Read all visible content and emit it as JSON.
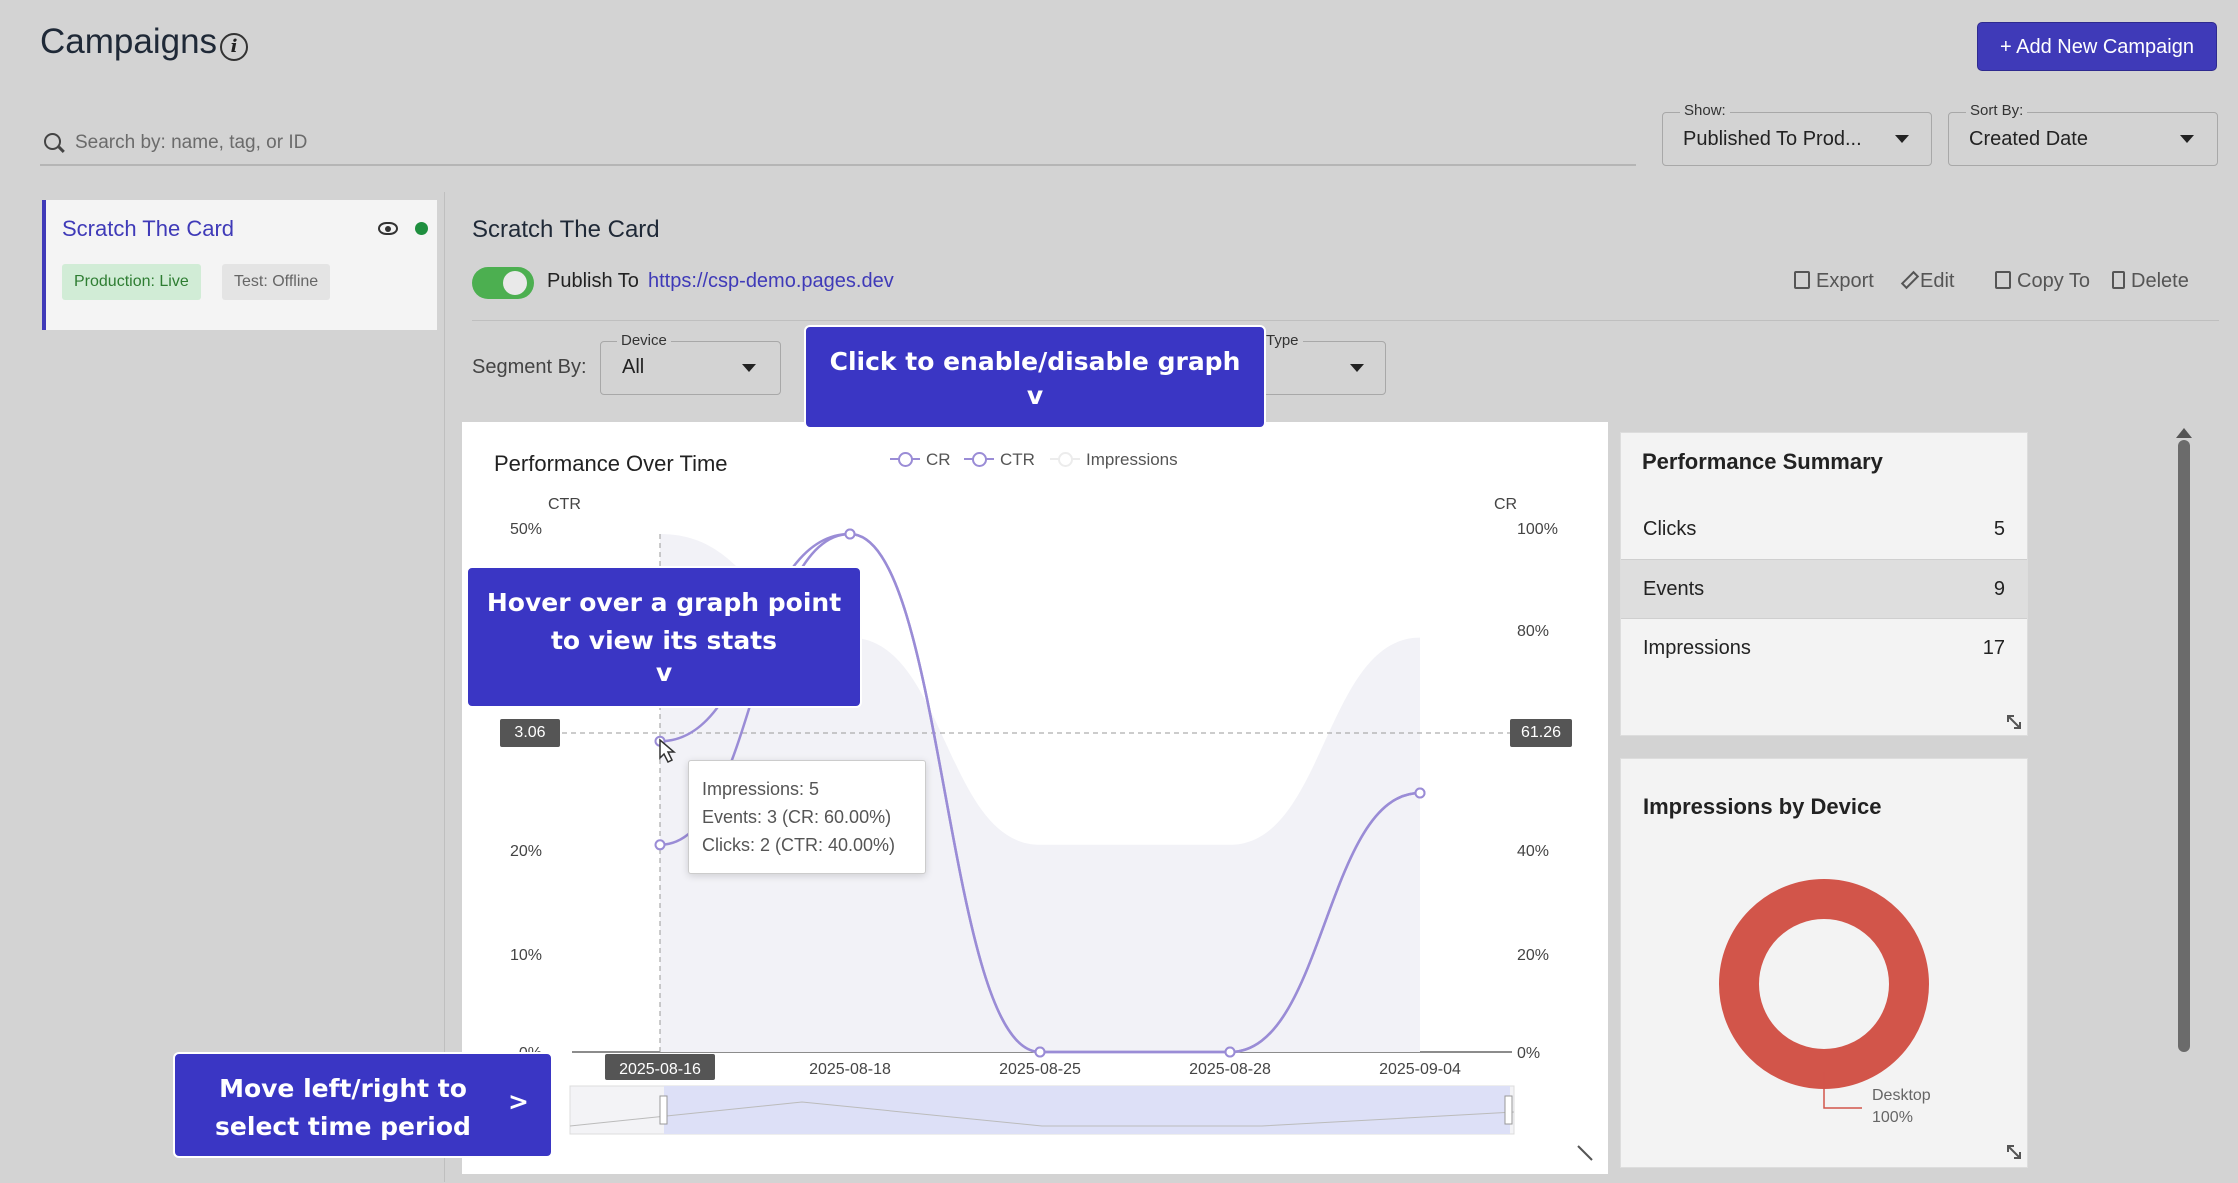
{
  "header": {
    "title": "Campaigns",
    "add_button": "+ Add New Campaign"
  },
  "search": {
    "placeholder": "Search by: name, tag, or ID"
  },
  "filters": {
    "show": {
      "label": "Show:",
      "value": "Published To Prod..."
    },
    "sort": {
      "label": "Sort By:",
      "value": "Created Date"
    }
  },
  "sidebar": {
    "campaign": {
      "name": "Scratch The Card",
      "badge_live": "Production: Live",
      "badge_test": "Test: Offline"
    }
  },
  "main": {
    "title": "Scratch The Card",
    "publish_label": "Publish To",
    "publish_url": "https://csp-demo.pages.dev",
    "actions": {
      "export": "Export",
      "edit": "Edit",
      "copy": "Copy To",
      "delete": "Delete"
    },
    "segment_label": "Segment By:",
    "device": {
      "label": "Device",
      "value": "All"
    },
    "type": {
      "label": "Type",
      "value": ""
    }
  },
  "chart": {
    "title": "Performance Over Time",
    "legend": {
      "cr": "CR",
      "ctr": "CTR",
      "impressions": "Impressions"
    },
    "left_axis_title": "CTR",
    "right_axis_title": "CR",
    "left_ticks": [
      "50%",
      "20%",
      "10%",
      "0%"
    ],
    "right_ticks": [
      "100%",
      "80%",
      "40%",
      "20%",
      "0%"
    ],
    "x_ticks": [
      "2025-08-16",
      "2025-08-18",
      "2025-08-25",
      "2025-08-28",
      "2025-09-04"
    ],
    "crosshair_left": "3.06",
    "crosshair_right": "61.26",
    "tooltip": {
      "line1": "Impressions: 5",
      "line2": "Events: 3 (CR: 60.00%)",
      "line3": "Clicks: 2 (CTR: 40.00%)"
    }
  },
  "chart_data": {
    "type": "line",
    "title": "Performance Over Time",
    "categories": [
      "2025-08-16",
      "2025-08-18",
      "2025-08-25",
      "2025-08-28",
      "2025-09-04"
    ],
    "series": [
      {
        "name": "CR",
        "values": [
          60,
          100,
          0,
          0,
          50
        ]
      },
      {
        "name": "CTR",
        "values": [
          40,
          100,
          0,
          0,
          50
        ]
      },
      {
        "name": "Impressions",
        "values": [
          5,
          4,
          2,
          2,
          4
        ]
      }
    ],
    "y_left": {
      "label": "CTR",
      "range": [
        0,
        50
      ]
    },
    "y_right": {
      "label": "CR",
      "range": [
        0,
        100
      ]
    },
    "legend_position": "top"
  },
  "summary": {
    "title": "Performance Summary",
    "rows": [
      {
        "label": "Clicks",
        "value": "5"
      },
      {
        "label": "Events",
        "value": "9"
      },
      {
        "label": "Impressions",
        "value": "17"
      }
    ]
  },
  "device_chart": {
    "title": "Impressions by Device",
    "label": "Desktop",
    "percent": "100%",
    "color": "#d2554a"
  },
  "tips": {
    "toggle_graph": "Click to enable/disable graph",
    "toggle_graph_arrow": "v",
    "hover_point_line1": "Hover over a graph point",
    "hover_point_line2": "to view its stats",
    "hover_point_arrow": "v",
    "time_period_line1": "Move left/right to",
    "time_period_line2": "select time period",
    "time_period_arrow": ">"
  },
  "colors": {
    "accent": "#3f3ab8",
    "line": "#9a8cd6",
    "live_green": "#1e8e3e",
    "tip_bg": "#3a36c4"
  }
}
